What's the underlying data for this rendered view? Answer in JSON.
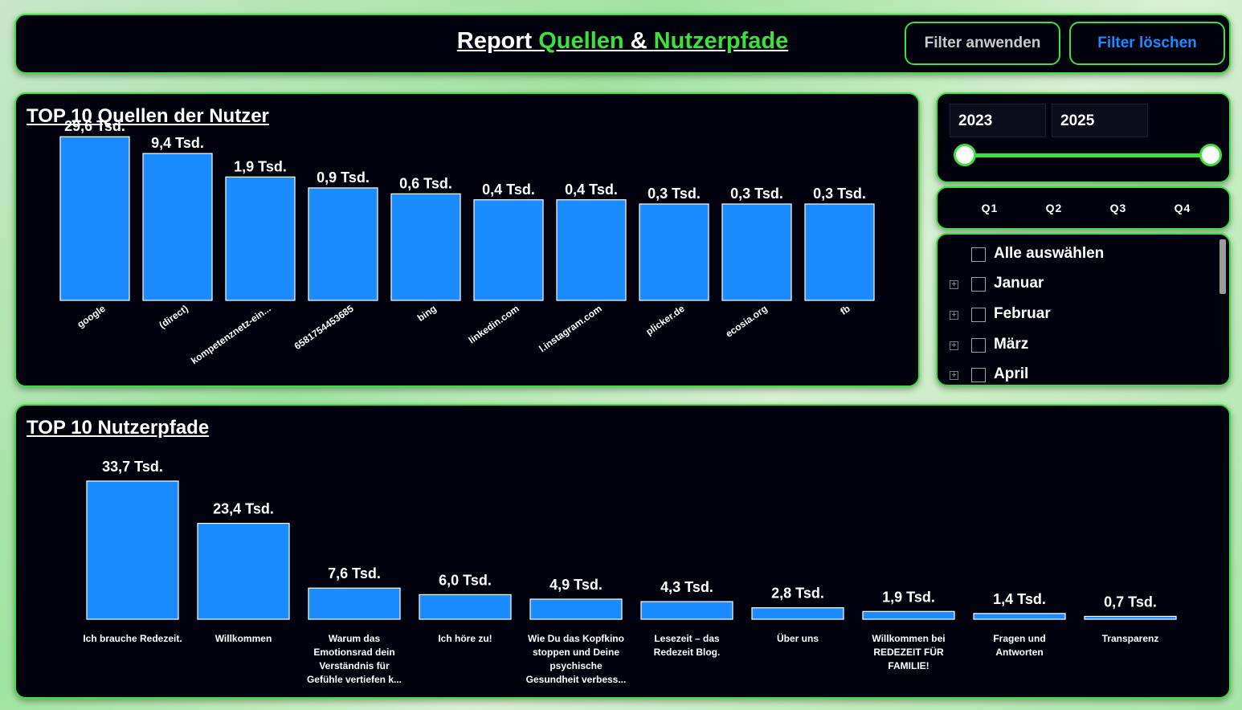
{
  "header": {
    "title_part1": "Report ",
    "title_part2": "Quellen",
    "title_part3": " & ",
    "title_part4": "Nutzerpfade",
    "apply_label": "Filter anwenden",
    "clear_label": "Filter löschen"
  },
  "colors": {
    "accent": "#3ce23c",
    "bar": "#1a8cff",
    "panel": "#02020f"
  },
  "years": {
    "from": "2023",
    "to": "2025"
  },
  "quarters": [
    "Q1",
    "Q2",
    "Q3",
    "Q4"
  ],
  "months": {
    "select_all": "Alle auswählen",
    "items": [
      "Januar",
      "Februar",
      "März",
      "April"
    ]
  },
  "chart_data": [
    {
      "type": "bar",
      "title": "TOP 10 Quellen der Nutzer",
      "categories": [
        "google",
        "(direct)",
        "kompetenznetz-ein...",
        "6581754453685",
        "bing",
        "linkedin.com",
        "l.instagram.com",
        "plicker.de",
        "ecosia.org",
        "fb"
      ],
      "values": [
        29.6,
        9.4,
        1.9,
        0.9,
        0.6,
        0.4,
        0.4,
        0.3,
        0.3,
        0.3
      ],
      "labels": [
        "29,6 Tsd.",
        "9,4 Tsd.",
        "1,9 Tsd.",
        "0,9 Tsd.",
        "0,6 Tsd.",
        "0,4 Tsd.",
        "0,4 Tsd.",
        "0,3 Tsd.",
        "0,3 Tsd.",
        "0,3 Tsd."
      ],
      "scale": "log",
      "unit": "Tsd."
    },
    {
      "type": "bar",
      "title": "TOP 10 Nutzerpfade",
      "categories": [
        "Ich brauche Redezeit.",
        "Willkommen",
        "Warum das Emotionsrad dein Verständnis für Gefühle vertiefen k...",
        "Ich höre zu!",
        "Wie Du das Kopfkino stoppen und Deine psychische Gesundheit verbess...",
        "Lesezeit – das Redezeit Blog.",
        "Über uns",
        "Willkommen bei REDEZEIT FÜR FAMILIE!",
        "Fragen und Antworten",
        "Transparenz"
      ],
      "category_lines": [
        [
          "Ich brauche Redezeit."
        ],
        [
          "Willkommen"
        ],
        [
          "Warum das",
          "Emotionsrad dein",
          "Verständnis für",
          "Gefühle vertiefen k..."
        ],
        [
          "Ich höre zu!"
        ],
        [
          "Wie Du das Kopfkino",
          "stoppen und Deine",
          "psychische",
          "Gesundheit verbess..."
        ],
        [
          "Lesezeit – das",
          "Redezeit Blog."
        ],
        [
          "Über uns"
        ],
        [
          "Willkommen bei",
          "REDEZEIT FÜR",
          "FAMILIE!"
        ],
        [
          "Fragen und",
          "Antworten"
        ],
        [
          "Transparenz"
        ]
      ],
      "values": [
        33.7,
        23.4,
        7.6,
        6.0,
        4.9,
        4.3,
        2.8,
        1.9,
        1.4,
        0.7
      ],
      "labels": [
        "33,7 Tsd.",
        "23,4 Tsd.",
        "7,6 Tsd.",
        "6,0 Tsd.",
        "4,9 Tsd.",
        "4,3 Tsd.",
        "2,8 Tsd.",
        "1,9 Tsd.",
        "1,4 Tsd.",
        "0,7 Tsd."
      ],
      "scale": "linear",
      "unit": "Tsd."
    }
  ]
}
